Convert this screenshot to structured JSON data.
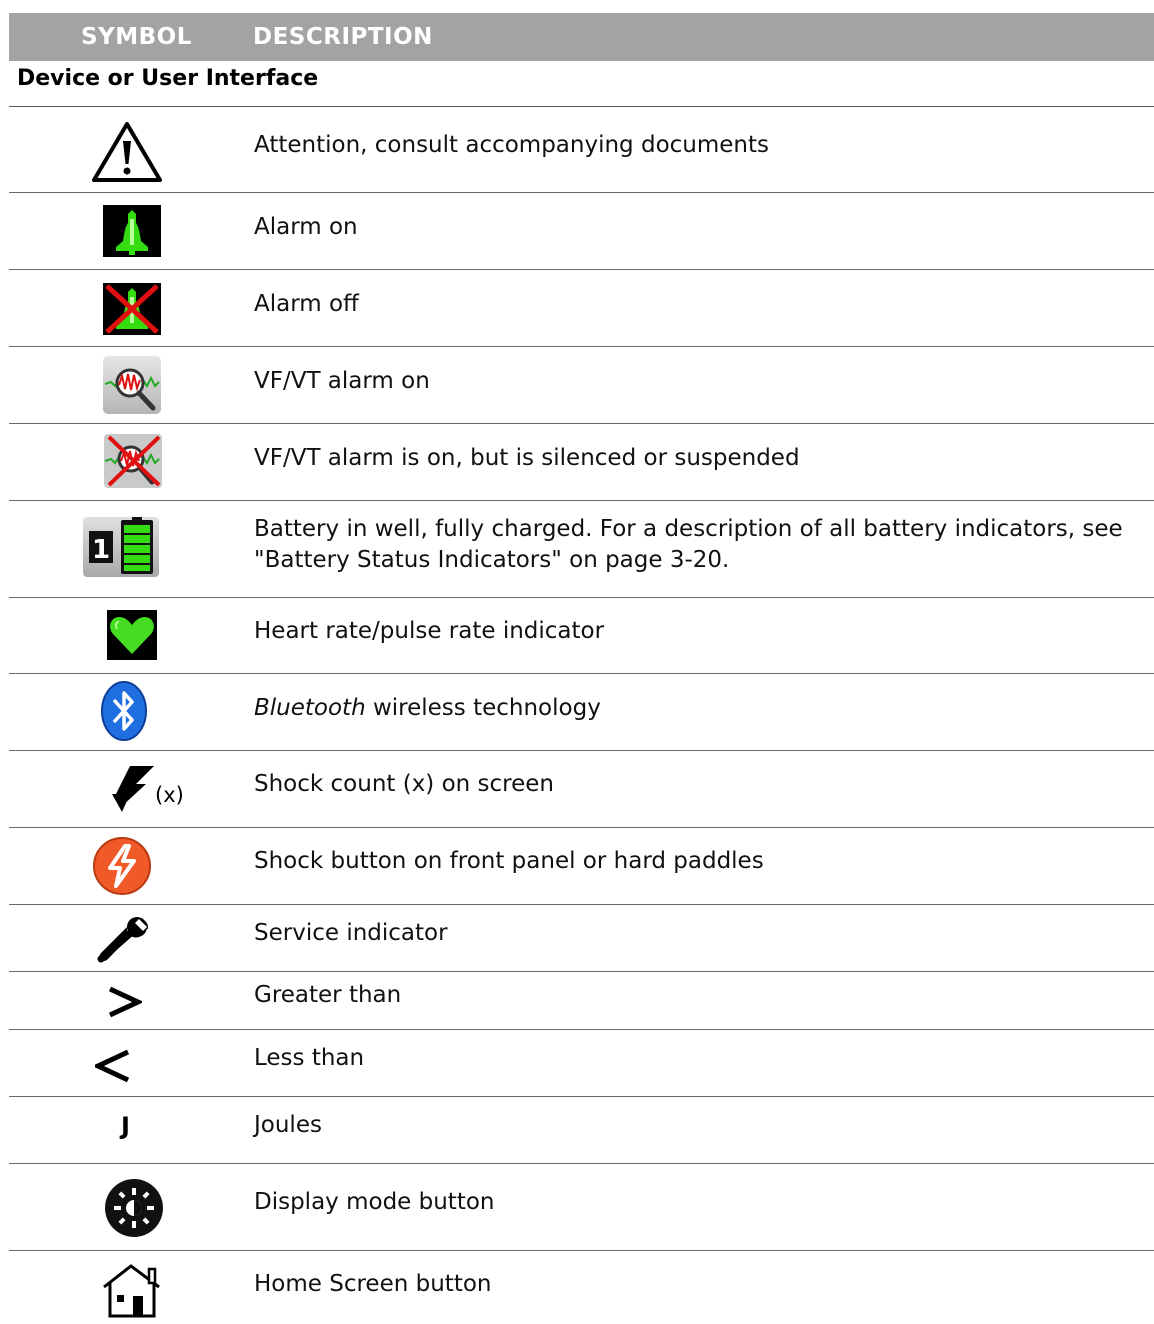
{
  "header": {
    "symbol_col": "SYMBOL",
    "description_col": "DESCRIPTION"
  },
  "section_title": "Device or User Interface",
  "rows": [
    {
      "icon": "attention-warning-icon",
      "description": "Attention, consult accompanying documents"
    },
    {
      "icon": "alarm-on-bell-icon",
      "description": "Alarm on"
    },
    {
      "icon": "alarm-off-bell-icon",
      "description": "Alarm off"
    },
    {
      "icon": "vf-vt-alarm-on-icon",
      "description": "VF/VT alarm on"
    },
    {
      "icon": "vf-vt-alarm-silenced-icon",
      "description": "VF/VT alarm is on, but is silenced or suspended"
    },
    {
      "icon": "battery-in-well-icon",
      "battery_well_number": "1",
      "description_line1": "Battery in well, fully charged. For a description of all battery indicators, see",
      "description_line2": "\"Battery Status Indicators\" on page 3-20."
    },
    {
      "icon": "heart-rate-indicator-icon",
      "description": "Heart rate/pulse rate indicator"
    },
    {
      "icon": "bluetooth-icon",
      "description_italic": "Bluetooth",
      "description_rest": " wireless technology"
    },
    {
      "icon": "shock-count-icon",
      "symbol_suffix": "(x)",
      "description": "Shock count (x) on screen"
    },
    {
      "icon": "shock-button-icon",
      "description": "Shock button on front panel or hard paddles"
    },
    {
      "icon": "wrench-service-icon",
      "description": "Service indicator"
    },
    {
      "icon": "greater-than-icon",
      "description": "Greater than"
    },
    {
      "icon": "less-than-icon",
      "description": "Less than"
    },
    {
      "icon": "joules-symbol",
      "symbol_text": "J",
      "description": "Joules"
    },
    {
      "icon": "display-mode-button-icon",
      "description": "Display mode button"
    },
    {
      "icon": "home-screen-button-icon",
      "description": "Home Screen button"
    }
  ],
  "colors": {
    "header_bg": "#a3a3a3",
    "header_text": "#ffffff",
    "alarm_green": "#33dd11",
    "alarm_red": "#e01010",
    "bluetooth_blue": "#1f6fe0",
    "shock_orange": "#f05a28",
    "heart_green": "#44dd22"
  }
}
